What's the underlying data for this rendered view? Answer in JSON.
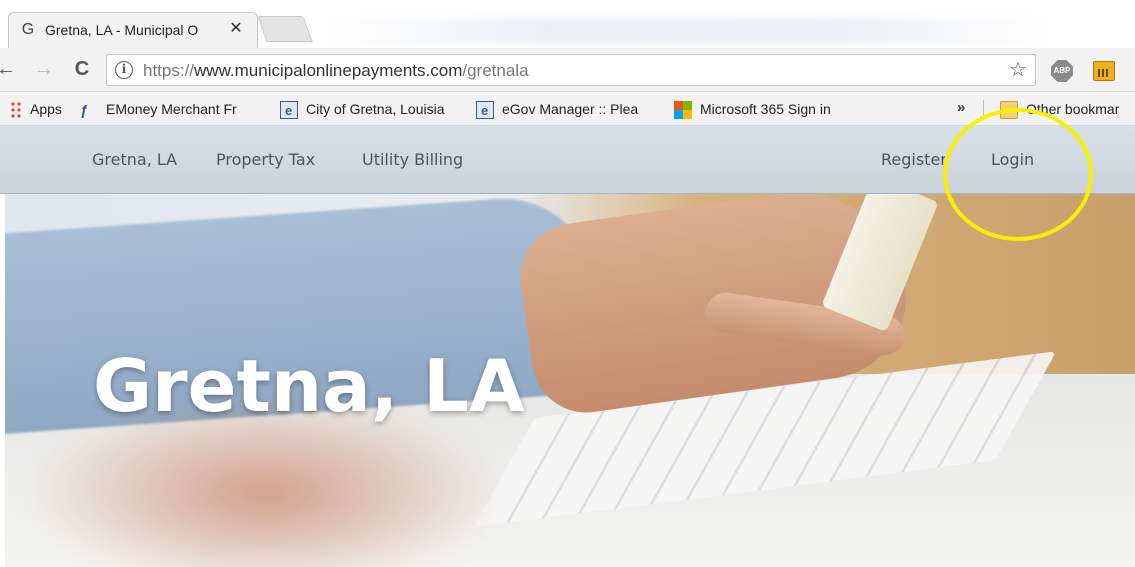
{
  "browser": {
    "tab": {
      "favicon": "G",
      "title": "Gretna, LA - Municipal O",
      "close": "✕"
    },
    "toolbar": {
      "back_icon": "←",
      "forward_icon": "→",
      "reload_icon": "C",
      "info_icon": "i",
      "url_prefix": "https://",
      "url_host": "www.municipalonlinepayments.com",
      "url_path": "/gretnala",
      "star_icon": "☆",
      "abp_label": "ABP"
    },
    "bookmarks": {
      "items": [
        {
          "label": "Apps",
          "icon": "apps-grid-icon"
        },
        {
          "label": "EMoney Merchant Fr",
          "icon": "emoney-icon"
        },
        {
          "label": "City of Gretna, Louisia",
          "icon": "document-icon"
        },
        {
          "label": "eGov Manager :: Plea",
          "icon": "document-icon"
        },
        {
          "label": "Microsoft 365 Sign in",
          "icon": "microsoft-icon"
        }
      ],
      "overflow": "»",
      "other": "Other bookmar"
    }
  },
  "site": {
    "nav": {
      "home": "Gretna, LA",
      "property_tax": "Property Tax",
      "utility_billing": "Utility Billing",
      "register": "Register",
      "login": "Login"
    },
    "hero": {
      "title": "Gretna, LA"
    }
  },
  "colors": {
    "nav_bg": "#d7e0e8",
    "nav_text": "#4a5560",
    "highlight": "#f7f000",
    "hero_title": "#ffffff"
  }
}
